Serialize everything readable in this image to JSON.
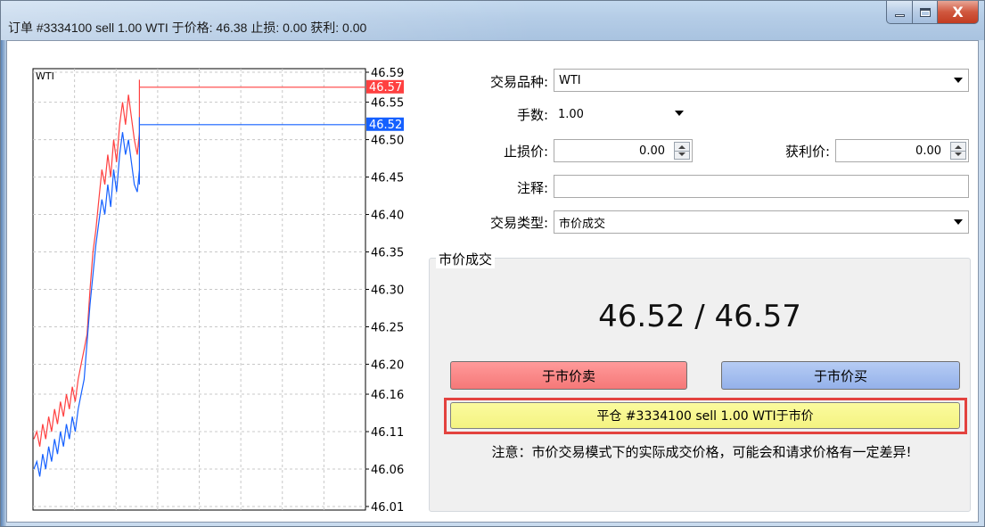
{
  "window": {
    "title": "订单 #3334100 sell 1.00 WTI 于价格: 46.38 止损: 0.00 获利: 0.00",
    "close_glyph": "X"
  },
  "chart_data": {
    "type": "line",
    "symbol": "WTI",
    "ylim": [
      46.01,
      46.59
    ],
    "y_ticks": [
      "46.59",
      "46.55",
      "46.50",
      "46.45",
      "46.40",
      "46.35",
      "46.30",
      "46.25",
      "46.20",
      "46.16",
      "46.11",
      "46.06",
      "46.01"
    ],
    "grid": true,
    "series": [
      {
        "color": "#ff4040",
        "last_label": "46.57",
        "values": [
          46.1,
          46.11,
          46.09,
          46.12,
          46.1,
          46.13,
          46.11,
          46.14,
          46.12,
          46.15,
          46.13,
          46.16,
          46.14,
          46.17,
          46.15,
          46.18,
          46.2,
          46.22,
          46.24,
          46.3,
          46.35,
          46.38,
          46.42,
          46.46,
          46.44,
          46.48,
          46.45,
          46.5,
          46.47,
          46.52,
          46.55,
          46.52,
          46.56,
          46.53,
          46.5,
          46.48,
          46.51,
          46.49,
          46.53,
          46.55,
          46.57,
          46.56,
          46.58,
          46.57,
          46.57,
          46.57
        ]
      },
      {
        "color": "#1560ff",
        "last_label": "46.52",
        "values": [
          46.06,
          46.07,
          46.05,
          46.08,
          46.06,
          46.09,
          46.07,
          46.1,
          46.08,
          46.11,
          46.09,
          46.12,
          46.1,
          46.13,
          46.11,
          46.14,
          46.16,
          46.18,
          46.23,
          46.28,
          46.32,
          46.36,
          46.39,
          46.42,
          46.4,
          46.44,
          46.41,
          46.46,
          46.43,
          46.48,
          46.51,
          46.48,
          46.5,
          46.47,
          46.44,
          46.43,
          46.46,
          46.44,
          46.48,
          46.5,
          46.52,
          46.51,
          46.53,
          46.52,
          46.52,
          46.52
        ]
      }
    ]
  },
  "form": {
    "symbol_label": "交易品种:",
    "symbol_value": "WTI",
    "volume_label": "手数:",
    "volume_value": "1.00",
    "sl_label": "止损价:",
    "sl_value": "0.00",
    "tp_label": "获利价:",
    "tp_value": "0.00",
    "comment_label": "注释:",
    "comment_value": "",
    "type_label": "交易类型:",
    "type_value": "市价成交"
  },
  "market": {
    "group_title": "市价成交",
    "price_text": "46.52 / 46.57",
    "sell_label": "于市价卖",
    "buy_label": "于市价买",
    "close_label": "平仓 #3334100 sell 1.00 WTI于市价",
    "note": "注意：市价交易模式下的实际成交价格，可能会和请求价格有一定差异!"
  },
  "colors": {
    "sell": "#f57878",
    "buy": "#94b1ea",
    "close": "#f4f382",
    "highlight": "#e3423f"
  }
}
